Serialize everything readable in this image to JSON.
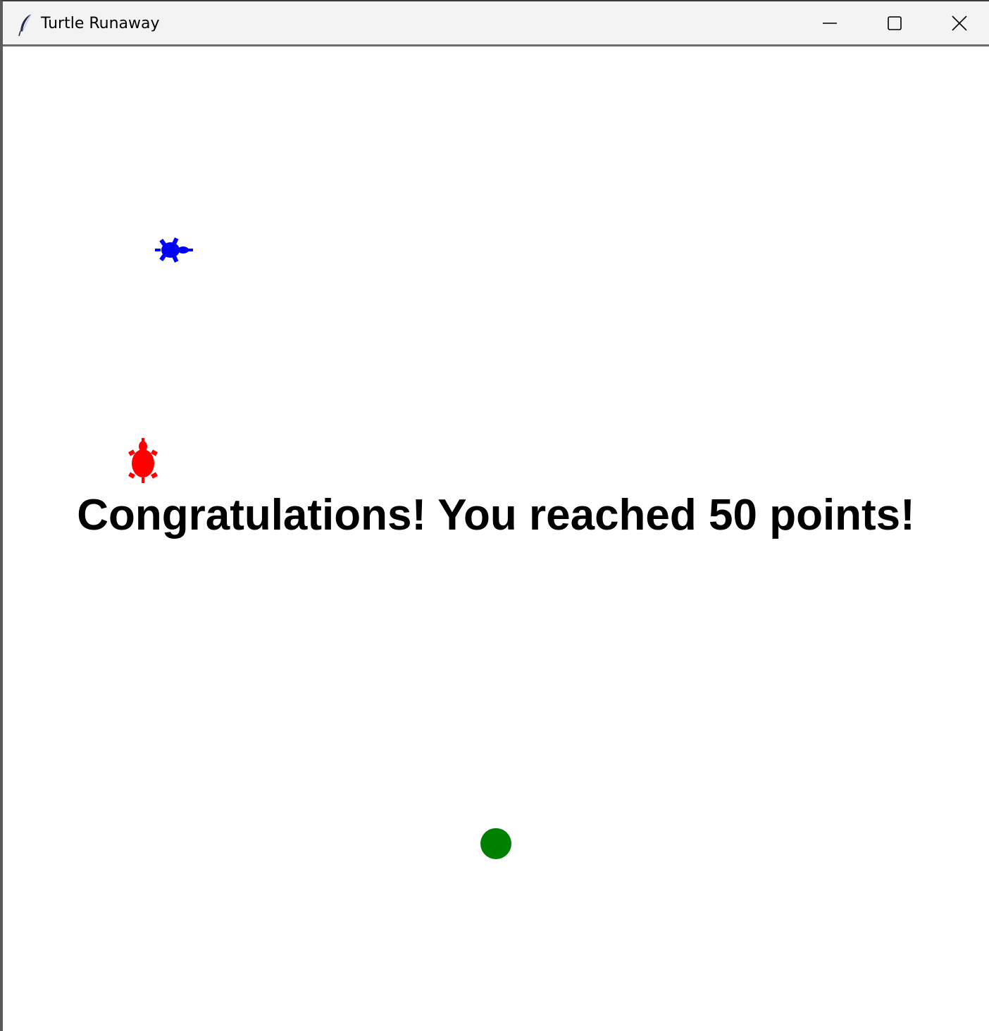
{
  "window": {
    "title": "Turtle Runaway",
    "app_icon": "feather-icon",
    "controls": {
      "minimize_icon": "minimize-icon",
      "maximize_icon": "maximize-icon",
      "close_icon": "close-icon"
    }
  },
  "game": {
    "message": "Congratulations! You reached 50 points!",
    "colors": {
      "chaser_turtle": "#0000ff",
      "runner_turtle": "#ff0000",
      "food": "#008000",
      "message": "#000000"
    },
    "sprites": {
      "chaser": "turtle-icon",
      "runner": "turtle-icon",
      "food": "circle-icon"
    }
  }
}
